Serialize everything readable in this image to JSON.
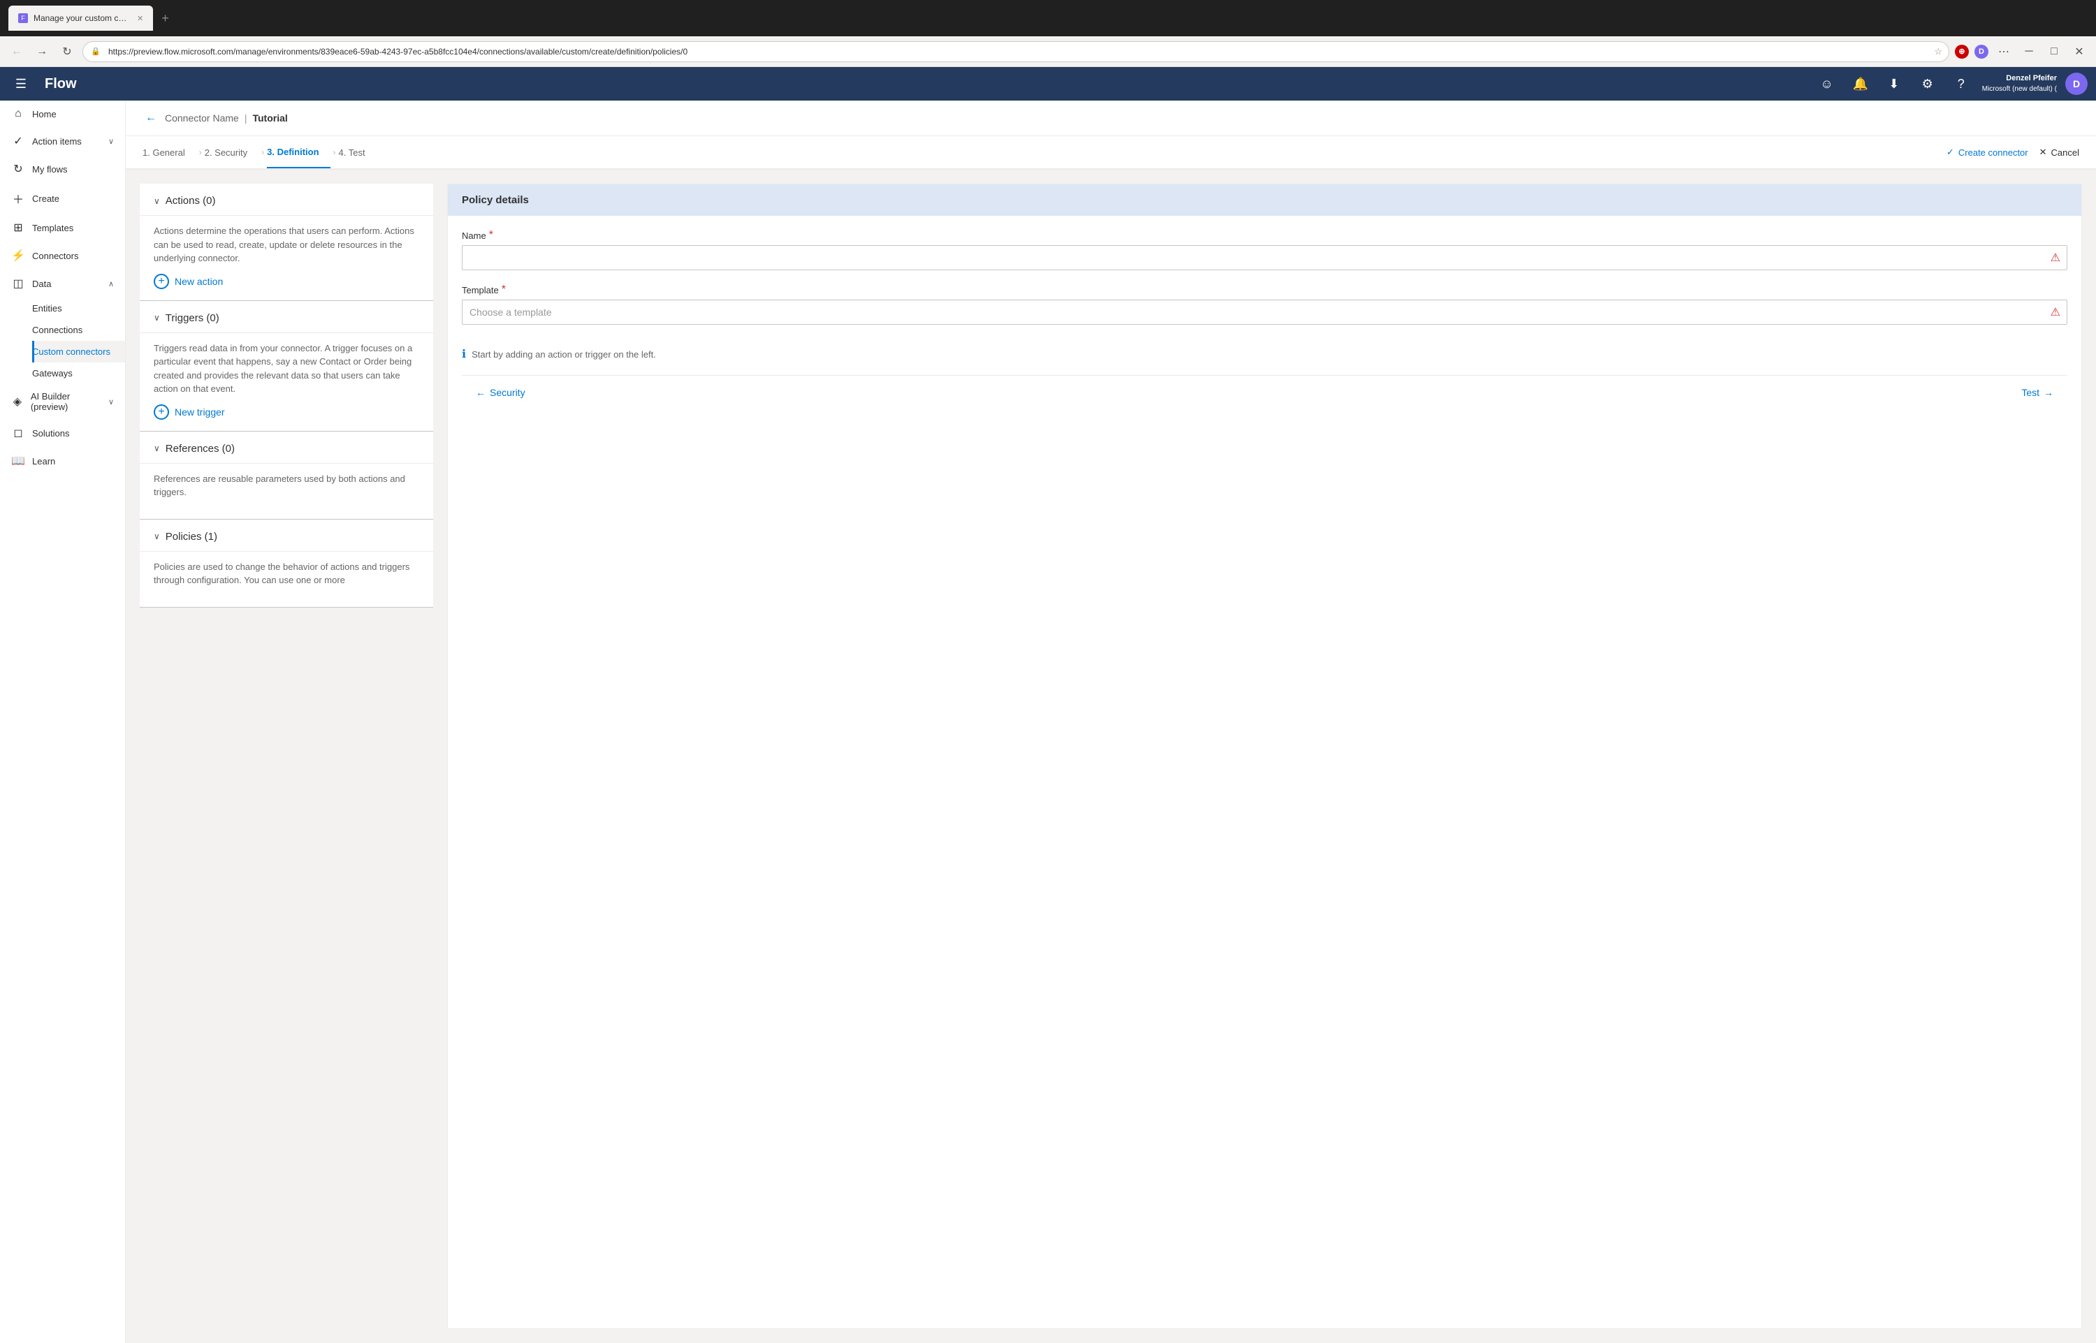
{
  "browser": {
    "tab_title": "Manage your custom connectors",
    "tab_active": true,
    "address": "https://preview.flow.microsoft.com/manage/environments/839eace6-59ab-4243-97ec-a5b8fcc104e4/connections/available/custom/create/definition/policies/0",
    "new_tab_label": "+",
    "back_btn": "←",
    "forward_btn": "→",
    "refresh_btn": "↻",
    "favicon_text": "F"
  },
  "topnav": {
    "hamburger": "☰",
    "logo": "Flow",
    "user_name": "Denzel Pfeifer",
    "user_org": "Microsoft (new default) (",
    "user_initials": "D"
  },
  "breadcrumb": {
    "back_icon": "←",
    "connector_name": "Connector Name",
    "separator": "|",
    "current": "Tutorial"
  },
  "wizard": {
    "steps": [
      {
        "label": "1. General",
        "active": false
      },
      {
        "label": "2. Security",
        "active": false
      },
      {
        "label": "3. Definition",
        "active": true
      },
      {
        "label": "4. Test",
        "active": false
      }
    ],
    "create_connector": "Create connector",
    "cancel": "Cancel",
    "check_icon": "✓",
    "x_icon": "✕"
  },
  "left_panel": {
    "actions": {
      "title": "Actions (0)",
      "description": "Actions determine the operations that users can perform. Actions can be used to read, create, update or delete resources in the underlying connector.",
      "new_action_label": "New action"
    },
    "triggers": {
      "title": "Triggers (0)",
      "description": "Triggers read data in from your connector. A trigger focuses on a particular event that happens, say a new Contact or Order being created and provides the relevant data so that users can take action on that event.",
      "new_trigger_label": "New trigger"
    },
    "references": {
      "title": "References (0)",
      "description": "References are reusable parameters used by both actions and triggers."
    },
    "policies": {
      "title": "Policies (1)",
      "description": "Policies are used to change the behavior of actions and triggers through configuration. You can use one or more"
    }
  },
  "policy_details": {
    "header": "Policy details",
    "name_label": "Name",
    "name_required": "*",
    "name_value": "",
    "name_placeholder": "",
    "template_label": "Template",
    "template_required": "*",
    "template_placeholder": "Choose a template",
    "info_text": "Start by adding an action or trigger on the left.",
    "nav_back": "Security",
    "nav_next": "Test"
  },
  "sidebar": {
    "items": [
      {
        "id": "home",
        "label": "Home",
        "icon": "⌂",
        "active": false
      },
      {
        "id": "action-items",
        "label": "Action items",
        "icon": "✓",
        "active": false,
        "has_chevron": true
      },
      {
        "id": "my-flows",
        "label": "My flows",
        "icon": "↻",
        "active": false
      },
      {
        "id": "create",
        "label": "Create",
        "icon": "+",
        "active": false
      },
      {
        "id": "templates",
        "label": "Templates",
        "icon": "⊞",
        "active": false
      },
      {
        "id": "connectors",
        "label": "Connectors",
        "icon": "⚡",
        "active": false
      },
      {
        "id": "data",
        "label": "Data",
        "icon": "◫",
        "active": false,
        "has_chevron": true
      },
      {
        "id": "entities",
        "label": "Entities",
        "sub": true,
        "active": false
      },
      {
        "id": "connections",
        "label": "Connections",
        "sub": true,
        "active": false
      },
      {
        "id": "custom-connectors",
        "label": "Custom connectors",
        "sub": true,
        "active": true
      },
      {
        "id": "gateways",
        "label": "Gateways",
        "sub": true,
        "active": false
      },
      {
        "id": "ai-builder",
        "label": "AI Builder (preview)",
        "icon": "◈",
        "active": false,
        "has_chevron": true
      },
      {
        "id": "solutions",
        "label": "Solutions",
        "icon": "◻",
        "active": false
      },
      {
        "id": "learn",
        "label": "Learn",
        "icon": "📖",
        "active": false
      }
    ]
  }
}
